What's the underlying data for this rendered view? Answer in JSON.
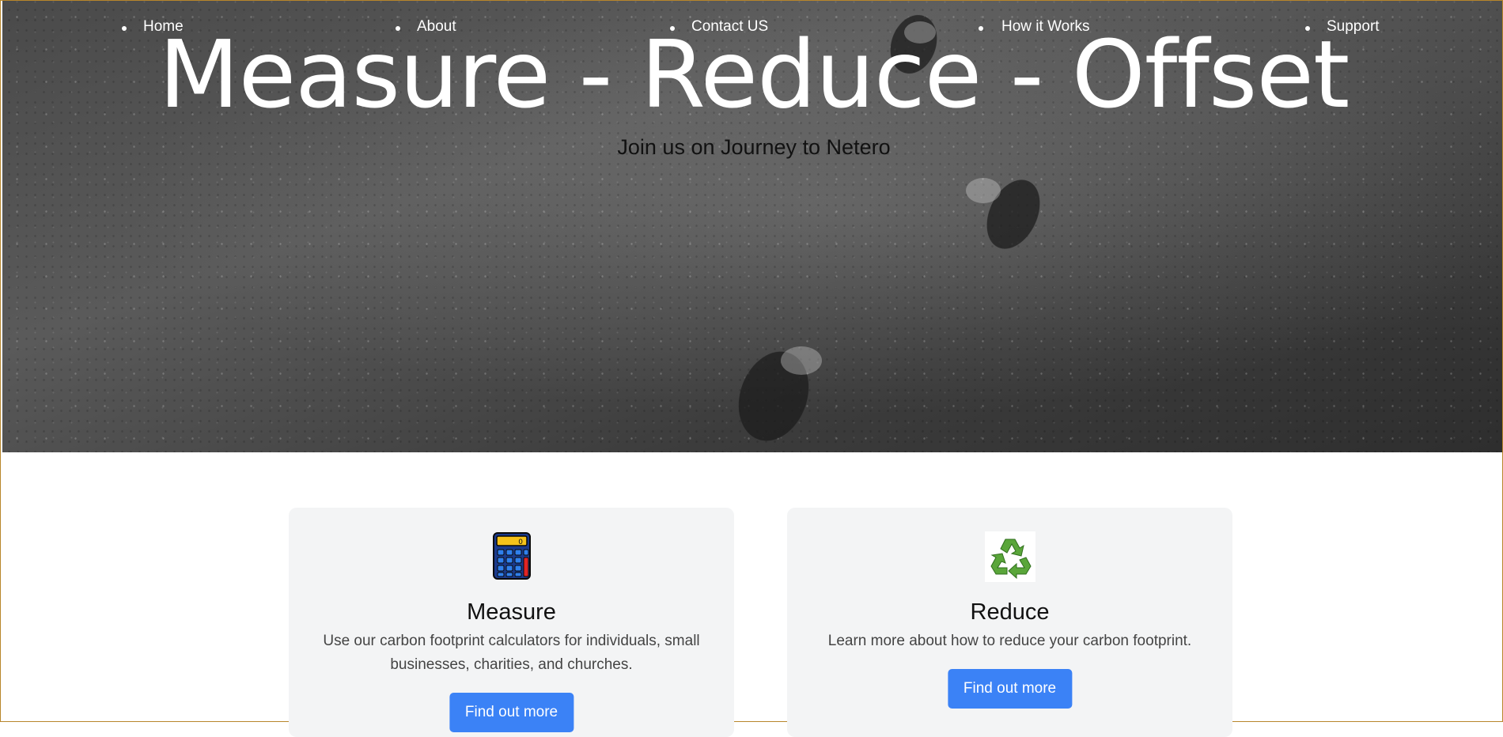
{
  "nav": {
    "items": [
      {
        "label": "Home"
      },
      {
        "label": "About"
      },
      {
        "label": "Contact US"
      },
      {
        "label": "How it Works"
      },
      {
        "label": "Support"
      }
    ]
  },
  "hero": {
    "title": "Measure - Reduce - Offset",
    "subtitle": "Join us on Journey to Netero"
  },
  "cards": [
    {
      "icon": "calculator-icon",
      "title": "Measure",
      "text": "Use our carbon footprint calculators for individuals, small businesses, charities, and churches.",
      "button": "Find out more"
    },
    {
      "icon": "recycle-icon",
      "title": "Reduce",
      "text": "Learn more about how to reduce your carbon footprint.",
      "button": "Find out more"
    }
  ],
  "colors": {
    "button": "#3b82f6",
    "card_bg": "#f3f4f5",
    "hero_text": "#ffffff"
  }
}
